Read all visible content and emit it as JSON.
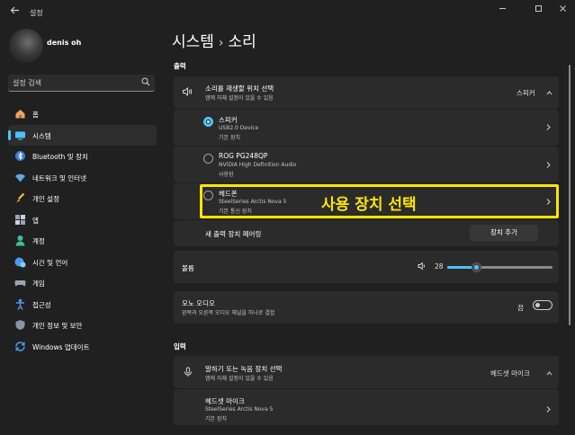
{
  "window": {
    "back_icon": "arrow-left-icon",
    "title": "설정",
    "controls": [
      "minimize-icon",
      "maximize-icon",
      "close-icon"
    ]
  },
  "profile": {
    "name": "denis oh"
  },
  "search": {
    "placeholder": "설정 검색",
    "icon": "search-icon"
  },
  "sidebar": {
    "items": [
      {
        "label": "홈",
        "icon": "home-icon"
      },
      {
        "label": "시스템",
        "icon": "system-icon",
        "selected": true
      },
      {
        "label": "Bluetooth 및 장치",
        "icon": "bluetooth-icon"
      },
      {
        "label": "네트워크 및 인터넷",
        "icon": "wifi-icon"
      },
      {
        "label": "개인 설정",
        "icon": "brush-icon"
      },
      {
        "label": "앱",
        "icon": "apps-icon"
      },
      {
        "label": "계정",
        "icon": "account-icon"
      },
      {
        "label": "시간 및 언어",
        "icon": "globe-clock-icon"
      },
      {
        "label": "게임",
        "icon": "gamepad-icon"
      },
      {
        "label": "접근성",
        "icon": "accessibility-icon"
      },
      {
        "label": "개인 정보 및 보안",
        "icon": "shield-icon"
      },
      {
        "label": "Windows 업데이트",
        "icon": "update-icon"
      }
    ]
  },
  "breadcrumb": {
    "parent": "시스템",
    "separator": "›",
    "current": "소리"
  },
  "output": {
    "heading": "출력",
    "choose": {
      "title": "소리를 재생할 위치 선택",
      "subtitle": "앱에 자체 설정이 있을 수 있음",
      "value": "스피커",
      "icon": "speaker-icon"
    },
    "devices": [
      {
        "name": "스피커",
        "detail": "USB2.0 Device",
        "status": "기본 장치",
        "selected": true
      },
      {
        "name": "ROG PG248QP",
        "detail": "NVIDIA High Definition Audio",
        "status": "사용함",
        "selected": false
      },
      {
        "name": "헤드폰",
        "detail": "SteelSeries Arctis Nova 5",
        "status": "기본 통신 장치",
        "selected": false
      }
    ],
    "pair": {
      "label": "새 출력 장치 페어링",
      "button": "장치 추가"
    },
    "volume": {
      "label": "볼륨",
      "value": "28",
      "level": 0.28
    },
    "mono": {
      "title": "모노 오디오",
      "subtitle": "왼쪽과 오른쪽 오디오 채널을 하나로 결합",
      "state": "끔"
    }
  },
  "input": {
    "heading": "입력",
    "choose": {
      "title": "말하기 또는 녹음 장치 선택",
      "subtitle": "앱에 자체 설정이 있을 수 있음",
      "value": "헤드셋 마이크",
      "icon": "microphone-icon"
    },
    "devices": [
      {
        "name": "헤드셋 마이크",
        "detail": "SteelSeries Arctis Nova 5",
        "status": "기본 장치"
      }
    ]
  },
  "annotation": {
    "text": "사용 장치 선택",
    "color": "#ffe600"
  },
  "colors": {
    "accent": "#4cc2ff",
    "background": "#202020",
    "card": "#2b2b2b"
  }
}
